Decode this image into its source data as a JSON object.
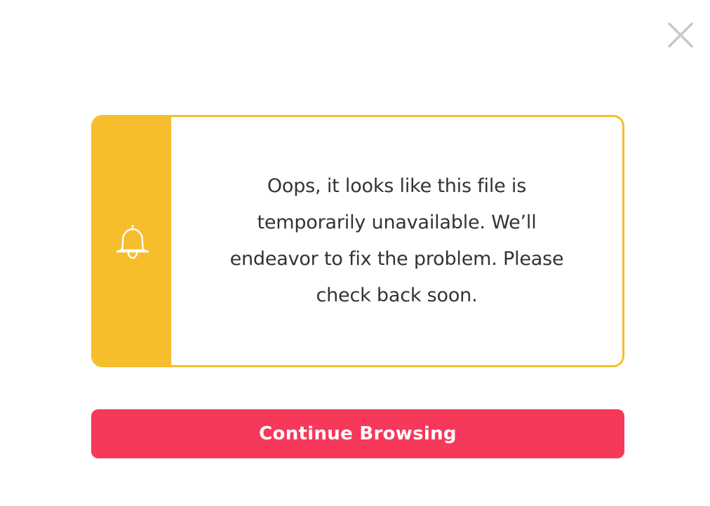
{
  "dialog": {
    "close_icon": "close-icon",
    "notice": {
      "icon": "bell-icon",
      "message": "Oops, it looks like this file is temporarily unavailable. We’ll endeavor to fix the problem. Please check back soon."
    },
    "continue_label": "Continue Browsing"
  },
  "colors": {
    "accent_yellow": "#f6bd2c",
    "button_red": "#f6385b",
    "close_gray": "#c8c8c8",
    "text": "#333333"
  }
}
